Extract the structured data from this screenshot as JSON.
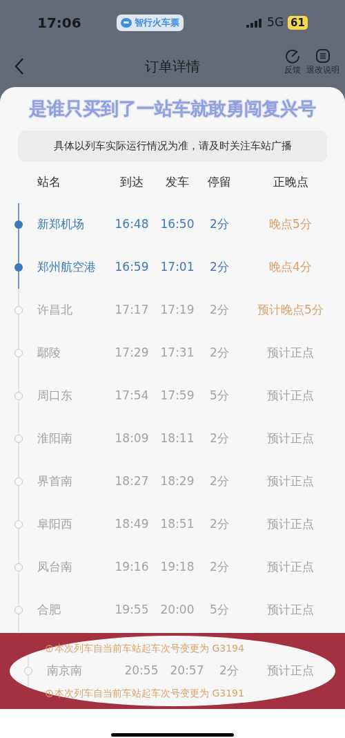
{
  "status_bar": {
    "time": "17:06",
    "app_badge": "智行火车票",
    "network": "5G",
    "battery": "61"
  },
  "nav": {
    "title": "订单详情",
    "actions": [
      "反馈",
      "退改说明"
    ]
  },
  "caption": "是谁只买到了一站车就敢勇闯复兴号",
  "notice": "具体以列车实际运行情况为准，请及时关注车站广播",
  "columns": [
    "站名",
    "到达",
    "发车",
    "停留",
    "正晚点"
  ],
  "stops": [
    {
      "name": "新郑机场",
      "arrive": "16:48",
      "depart": "16:50",
      "stay": "2分",
      "status": "晚点5分",
      "passed": true,
      "late": true
    },
    {
      "name": "郑州航空港",
      "arrive": "16:59",
      "depart": "17:01",
      "stay": "2分",
      "status": "晚点4分",
      "passed": true,
      "late": true
    },
    {
      "name": "许昌北",
      "arrive": "17:17",
      "depart": "17:19",
      "stay": "2分",
      "status": "预计晚点5分",
      "passed": false,
      "late": true
    },
    {
      "name": "鄢陵",
      "arrive": "17:29",
      "depart": "17:31",
      "stay": "2分",
      "status": "预计正点",
      "passed": false,
      "late": false
    },
    {
      "name": "周口东",
      "arrive": "17:54",
      "depart": "17:59",
      "stay": "5分",
      "status": "预计正点",
      "passed": false,
      "late": false
    },
    {
      "name": "淮阳南",
      "arrive": "18:09",
      "depart": "18:11",
      "stay": "2分",
      "status": "预计正点",
      "passed": false,
      "late": false
    },
    {
      "name": "界首南",
      "arrive": "18:27",
      "depart": "18:29",
      "stay": "2分",
      "status": "预计正点",
      "passed": false,
      "late": false
    },
    {
      "name": "阜阳西",
      "arrive": "18:49",
      "depart": "18:51",
      "stay": "2分",
      "status": "预计正点",
      "passed": false,
      "late": false
    },
    {
      "name": "凤台南",
      "arrive": "19:16",
      "depart": "19:18",
      "stay": "2分",
      "status": "预计正点",
      "passed": false,
      "late": false
    },
    {
      "name": "合肥",
      "arrive": "19:55",
      "depart": "20:00",
      "stay": "5分",
      "status": "预计正点",
      "passed": false,
      "late": false
    }
  ],
  "highlight": {
    "before_note": "本次列车自当前车站起车次号变更为 G3194",
    "stop": {
      "name": "南京南",
      "arrive": "20:55",
      "depart": "20:57",
      "stay": "2分",
      "status": "预计正点",
      "passed": false,
      "late": false
    },
    "after_note": "本次列车自当前车站起车次号变更为 G3191"
  }
}
